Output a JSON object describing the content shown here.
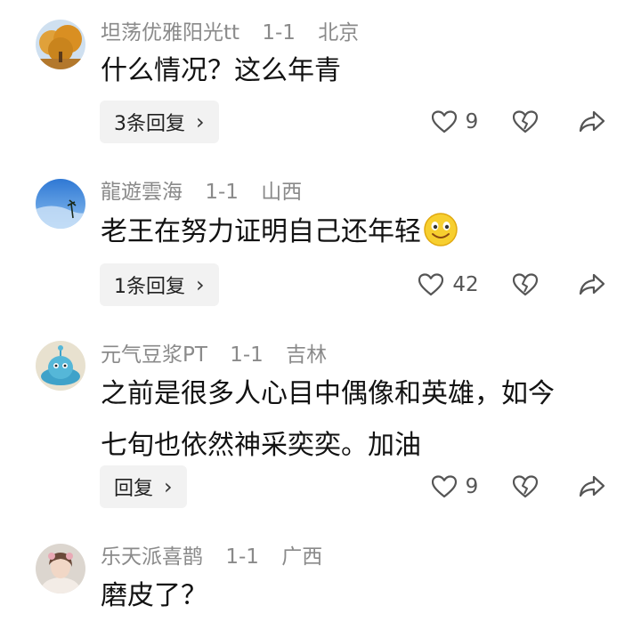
{
  "comments": [
    {
      "username": "坦荡优雅阳光tt",
      "date": "1-1",
      "location": "北京",
      "text_lines": [
        "什么情况？这么年青"
      ],
      "reply_label": "3条回复",
      "like_count": "9",
      "avatar": "golden-tree-avatar"
    },
    {
      "username": "龍遊雲海",
      "date": "1-1",
      "location": "山西",
      "text_lines": [
        "老王在努力证明自己还年轻"
      ],
      "has_emoji": "smile-emoji",
      "reply_label": "1条回复",
      "like_count": "42",
      "avatar": "blue-sky-avatar"
    },
    {
      "username": "元气豆浆PT",
      "date": "1-1",
      "location": "吉林",
      "text_lines": [
        "之前是很多人心目中偶像和英雄，如今",
        "七旬也依然神采奕奕。加油"
      ],
      "reply_label": "回复",
      "like_count": "9",
      "avatar": "cartoon-creature-avatar"
    },
    {
      "username": "乐天派喜鹊",
      "date": "1-1",
      "location": "广西",
      "text_lines": [
        "磨皮了？"
      ],
      "avatar": "girl-photo-avatar"
    }
  ],
  "colors": {
    "meta_text": "#8a8a8a",
    "reply_bg": "#f2f2f2",
    "icon": "#555555"
  }
}
